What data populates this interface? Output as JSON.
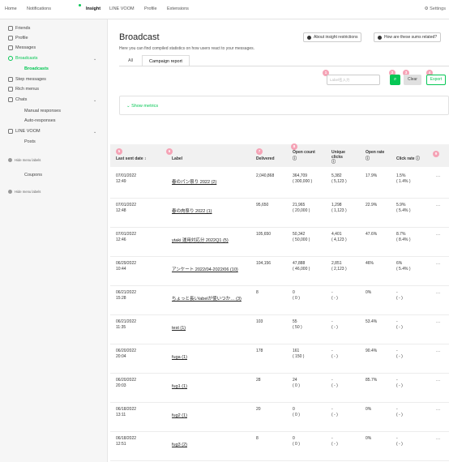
{
  "topnav": {
    "items": [
      "Home",
      "Notifications",
      "Insight",
      "LINE VOOM",
      "Profile",
      "Extensions"
    ],
    "settings": "⚙ Settings"
  },
  "sidebar": {
    "friends": "Friends",
    "profile": "Profile",
    "messages": "Messages",
    "broadcasts": "Broadcasts",
    "broadcasts_sub": "Broadcasts",
    "step_messages": "Step messages",
    "rich_menus": "Rich menus",
    "chats": "Chats",
    "manual_responses": "Manual responses",
    "auto_responses": "Auto-responses",
    "line_voom": "LINE VOOM",
    "posts": "Posts",
    "hide_labels_1": "Hide menu labels",
    "coupons": "Coupons",
    "hide_labels_2": "Hide menu labels"
  },
  "main": {
    "title": "Broadcast",
    "subtitle": "Here you can find compiled statistics on how users react to your messages.",
    "about_button": "About insight restrictions",
    "sums_button": "How are these sums related?",
    "tabs": [
      "All",
      "Campaign report"
    ],
    "search_placeholder": "Label名入力",
    "clear": "Clear",
    "export": "Export",
    "show_metrics": "Show metrics"
  },
  "badges": [
    "1",
    "2",
    "3",
    "4",
    "5",
    "6",
    "7",
    "8",
    "9"
  ],
  "table": {
    "headers": {
      "last_sent": "Last sent date ↕",
      "label": "Label",
      "delivered": "Delivered",
      "open_count": "Open count",
      "unique_clicks_1": "Unique",
      "unique_clicks_2": "clicks",
      "open_rate": "Open rate",
      "click_rate": "Click rate ⓘ",
      "info": "ⓘ"
    },
    "rows": [
      {
        "date": "07/01/2022",
        "time": "12:49",
        "label": "春のパン祭り 2022 (2)",
        "delivered": "2,040,868",
        "open": "364,709",
        "open_sub": "( 300,000 )",
        "clicks": "5,382",
        "clicks_sub": "( 5,123 )",
        "open_rate": "17.9%",
        "click_rate": "1.5%",
        "click_rate_sub": "( 1.4% )",
        "more": "···"
      },
      {
        "date": "07/01/2022",
        "time": "12:48",
        "label": "春の肉祭り 2022 (1)",
        "delivered": "95,650",
        "open": "21,965",
        "open_sub": "( 20,000 )",
        "clicks": "1,298",
        "clicks_sub": "( 1,123 )",
        "open_rate": "22.9%",
        "click_rate": "5.9%",
        "click_rate_sub": "( 5.4% )",
        "more": "···"
      },
      {
        "date": "07/01/2022",
        "time": "12:46",
        "label": "ytaki 運用対応分 2022Q1 (5)",
        "delivered": "105,650",
        "open": "50,342",
        "open_sub": "( 50,000 )",
        "clicks": "4,401",
        "clicks_sub": "( 4,123 )",
        "open_rate": "47.6%",
        "click_rate": "8.7%",
        "click_rate_sub": "( 8.4% )",
        "more": "···"
      },
      {
        "date": "06/29/2022",
        "time": "10:44",
        "label": "アンケート 2022/04-2022/06 (10)",
        "delivered": "104,156",
        "open": "47,888",
        "open_sub": "( 46,000 )",
        "clicks": "2,851",
        "clicks_sub": "( 2,123 )",
        "open_rate": "46%",
        "click_rate": "6%",
        "click_rate_sub": "( 5.4% )",
        "more": "···"
      },
      {
        "date": "06/21/2022",
        "time": "15:28",
        "label": "ちょっと長いlabelが使いつか… (3)",
        "delivered": "8",
        "open": "0",
        "open_sub": "( 0 )",
        "clicks": "-",
        "clicks_sub": "( - )",
        "open_rate": "0%",
        "click_rate": "-",
        "click_rate_sub": "( - )",
        "more": "···"
      },
      {
        "date": "06/21/2022",
        "time": "11:35",
        "label": "test (1)",
        "delivered": "103",
        "open": "55",
        "open_sub": "( 50 )",
        "clicks": "-",
        "clicks_sub": "( - )",
        "open_rate": "53.4%",
        "click_rate": "-",
        "click_rate_sub": "( - )",
        "more": "···"
      },
      {
        "date": "06/20/2022",
        "time": "20:04",
        "label": "fuga (1)",
        "delivered": "178",
        "open": "161",
        "open_sub": "( 150 )",
        "clicks": "-",
        "clicks_sub": "( - )",
        "open_rate": "90.4%",
        "click_rate": "-",
        "click_rate_sub": "( - )",
        "more": "···"
      },
      {
        "date": "06/20/2022",
        "time": "20:03",
        "label": "fug1 (1)",
        "delivered": "28",
        "open": "24",
        "open_sub": "( 0 )",
        "clicks": "-",
        "clicks_sub": "( - )",
        "open_rate": "85.7%",
        "click_rate": "-",
        "click_rate_sub": "( - )",
        "more": "···"
      },
      {
        "date": "06/18/2022",
        "time": "13:11",
        "label": "fug2 (1)",
        "delivered": "20",
        "open": "0",
        "open_sub": "( 0 )",
        "clicks": "-",
        "clicks_sub": "( - )",
        "open_rate": "0%",
        "click_rate": "-",
        "click_rate_sub": "( - )",
        "more": "···"
      },
      {
        "date": "06/18/2022",
        "time": "12:51",
        "label": "fug3 (2)",
        "delivered": "8",
        "open": "0",
        "open_sub": "( 0 )",
        "clicks": "-",
        "clicks_sub": "( - )",
        "open_rate": "0%",
        "click_rate": "-",
        "click_rate_sub": "( - )",
        "more": "···"
      }
    ]
  },
  "colors": {
    "accent": "#06c755",
    "badge": "#f5a3b6"
  }
}
